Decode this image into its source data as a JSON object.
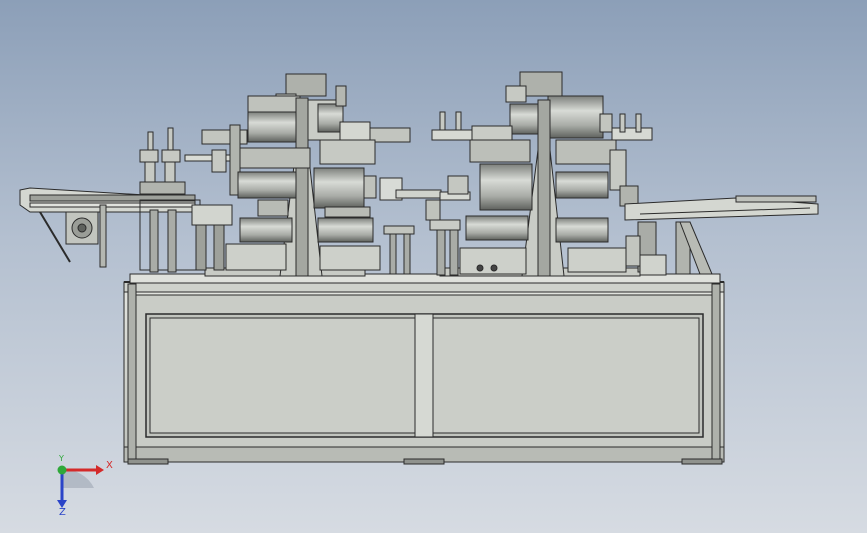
{
  "triad": {
    "x_label": "X",
    "y_label": "Y",
    "z_label": "Z",
    "x_color": "#d42a2a",
    "y_color": "#2fa83a",
    "z_color": "#2a44c8"
  },
  "model": {
    "steel_light": "#d9dcd6",
    "steel_mid": "#b5b8b3",
    "steel_dark": "#6f726e",
    "line_color": "#2b2b2b"
  }
}
